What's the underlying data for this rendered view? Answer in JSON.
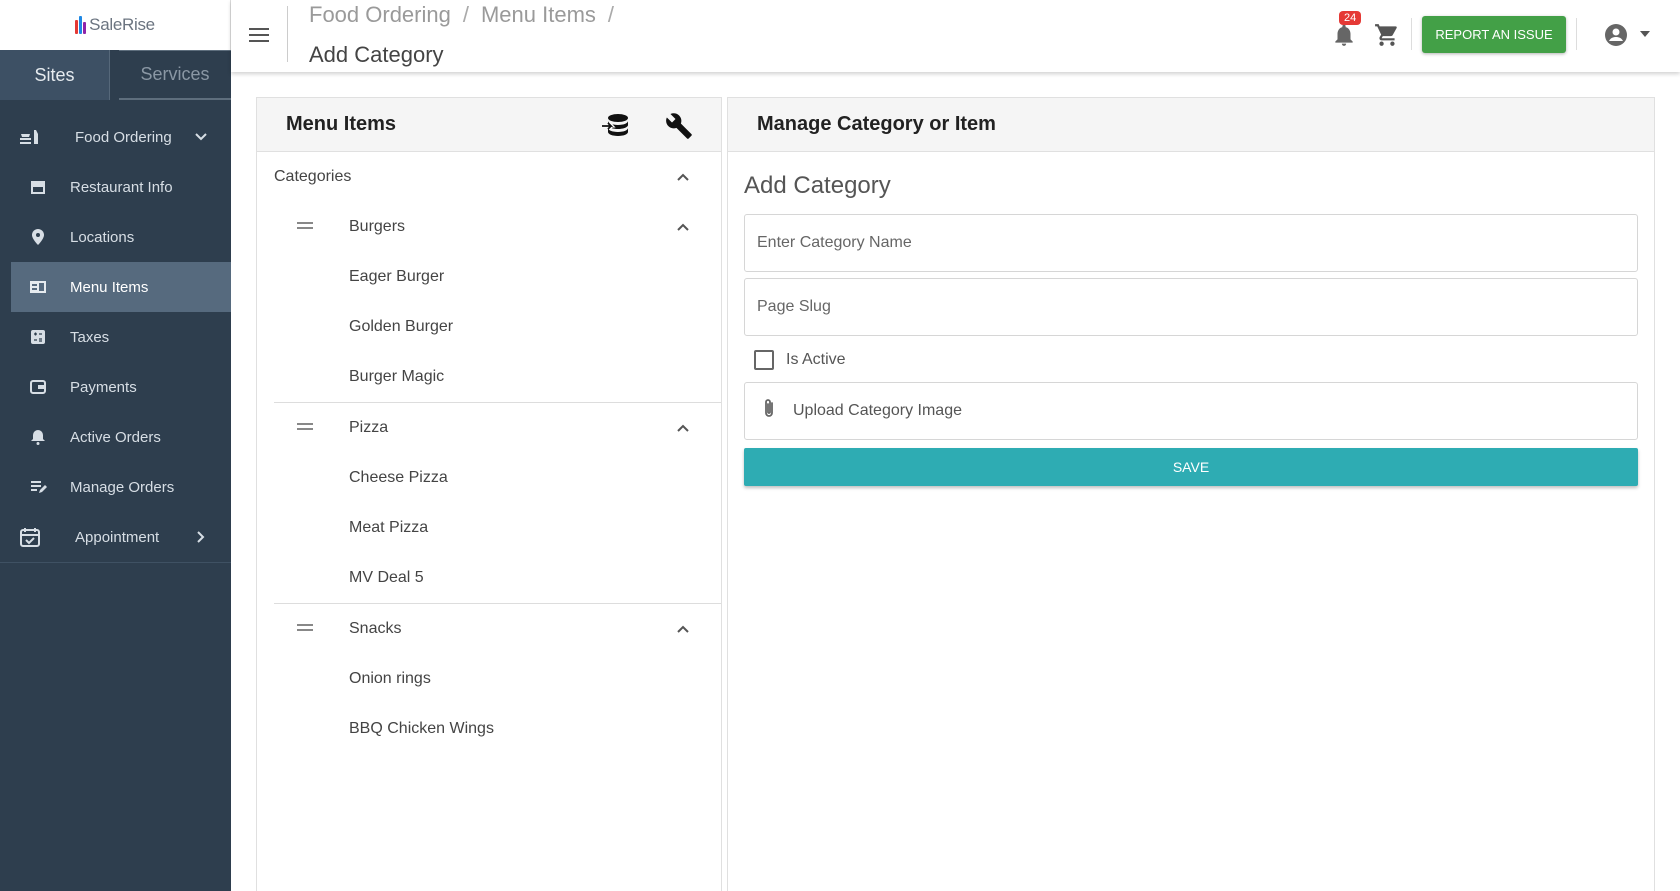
{
  "brand": {
    "name": "SaleRise"
  },
  "sidebar": {
    "tabs": [
      {
        "label": "Sites",
        "active": true
      },
      {
        "label": "Services",
        "active": false
      }
    ],
    "groups": [
      {
        "label": "Food Ordering",
        "icon": "food-ordering-icon",
        "expanded": true
      },
      {
        "label": "Appointment",
        "icon": "calendar-check-icon",
        "expanded": false
      }
    ],
    "items": [
      {
        "label": "Restaurant Info",
        "icon": "store-icon"
      },
      {
        "label": "Locations",
        "icon": "location-pin-icon"
      },
      {
        "label": "Menu Items",
        "icon": "menu-book-icon",
        "active": true
      },
      {
        "label": "Taxes",
        "icon": "calculator-icon"
      },
      {
        "label": "Payments",
        "icon": "wallet-icon"
      },
      {
        "label": "Active Orders",
        "icon": "bell-ring-icon"
      },
      {
        "label": "Manage Orders",
        "icon": "edit-list-icon"
      }
    ]
  },
  "header": {
    "breadcrumb": [
      "Food Ordering",
      "Menu Items"
    ],
    "separator": "/",
    "title": "Add Category",
    "notification_count": "24",
    "report_button": "REPORT AN ISSUE"
  },
  "menu_panel": {
    "title": "Menu Items",
    "categories_label": "Categories",
    "groups": [
      {
        "name": "Burgers",
        "items": [
          "Eager Burger",
          "Golden Burger",
          "Burger Magic"
        ]
      },
      {
        "name": "Pizza",
        "items": [
          "Cheese Pizza",
          "Meat Pizza",
          "MV Deal 5"
        ]
      },
      {
        "name": "Snacks",
        "items": [
          "Onion rings",
          "BBQ Chicken Wings"
        ]
      }
    ]
  },
  "manage_panel": {
    "title": "Manage Category or Item",
    "form_title": "Add Category",
    "name_placeholder": "Enter Category Name",
    "name_value": "",
    "slug_placeholder": "Page Slug",
    "slug_value": "",
    "active_label": "Is Active",
    "active_checked": false,
    "upload_label": "Upload Category Image",
    "save_label": "SAVE"
  },
  "colors": {
    "sidebar_bg": "#2e3e4e",
    "sidebar_active": "#566a7e",
    "report_button": "#43a047",
    "save_button": "#2eacb3",
    "badge": "#e53935"
  }
}
